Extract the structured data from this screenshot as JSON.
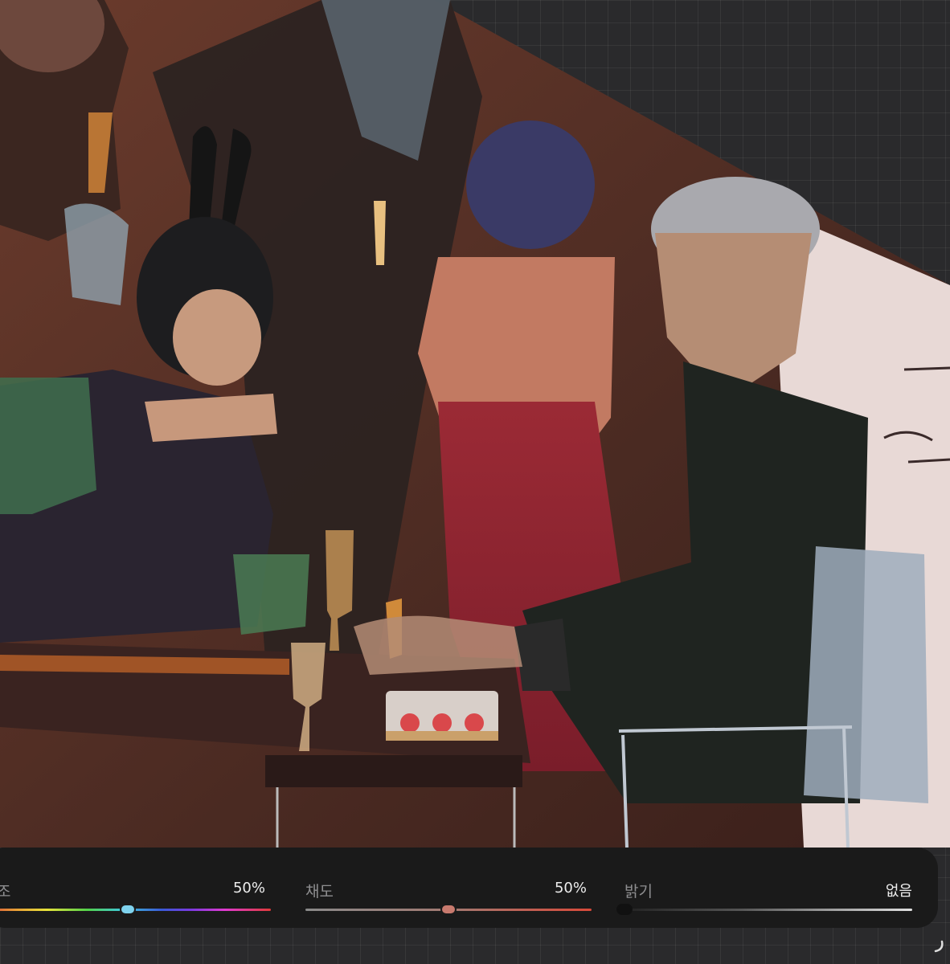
{
  "panel": {
    "hue": {
      "label": "조",
      "value_text": "50%",
      "level": 0.5
    },
    "saturation": {
      "label": "채도",
      "value_text": "50%",
      "level": 0.5
    },
    "brightness": {
      "label": "밝기",
      "value_text": "없음",
      "level": 0.0
    }
  },
  "colors": {
    "canvas_bg": "#2a2a2c",
    "panel_bg": "#1a1a1a",
    "hue_thumb": "#7fd3ee",
    "saturation_thumb": "#c87a6e",
    "saturation_track": "#d94a3a",
    "brightness_track": "#e0e0e0"
  },
  "icons": {
    "corner": "curve-arrow-icon"
  }
}
